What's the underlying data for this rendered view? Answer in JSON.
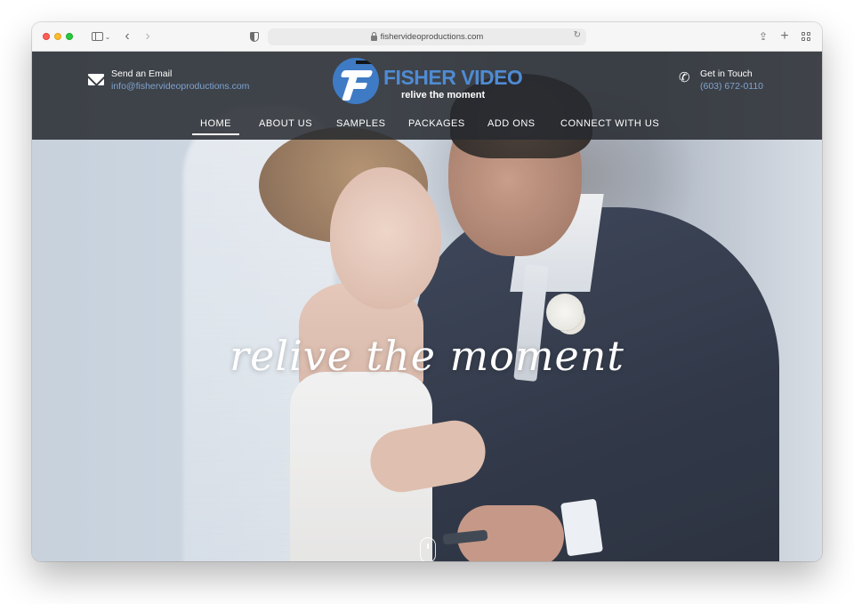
{
  "browser": {
    "url": "fishervideoproductions.com",
    "icons": {
      "sidebar": "sidebar-icon",
      "back": "chevron-left-icon",
      "forward": "chevron-right-icon",
      "privacy": "shield-icon",
      "reload": "reload-icon",
      "share": "share-icon",
      "new_tab": "plus-icon",
      "tab_overview": "grid-icon"
    },
    "glyphs": {
      "chevron_small": "⌄",
      "back": "‹",
      "forward": "›",
      "reload": "↻",
      "share": "⇪",
      "new_tab": "+"
    }
  },
  "header": {
    "email": {
      "label": "Send an Email",
      "value": "info@fishervideoproductions.com",
      "icon": "envelope-icon"
    },
    "phone": {
      "label": "Get in Touch",
      "value": "(603) 672-0110",
      "icon": "phone-icon",
      "glyph": "✆"
    },
    "logo": {
      "name": "FISHER VIDEO",
      "tagline": "relive the moment"
    },
    "nav": [
      {
        "label": "HOME",
        "active": true
      },
      {
        "label": "ABOUT US",
        "active": false
      },
      {
        "label": "SAMPLES",
        "active": false
      },
      {
        "label": "PACKAGES",
        "active": false
      },
      {
        "label": "ADD ONS",
        "active": false
      },
      {
        "label": "CONNECT WITH US",
        "active": false
      }
    ]
  },
  "hero": {
    "tagline": "relive the moment",
    "scroll_indicator": "mouse-scroll-icon"
  },
  "colors": {
    "accent": "#4f8bd3",
    "contact_link": "#7fa3cf",
    "header_bg": "#262a30"
  }
}
